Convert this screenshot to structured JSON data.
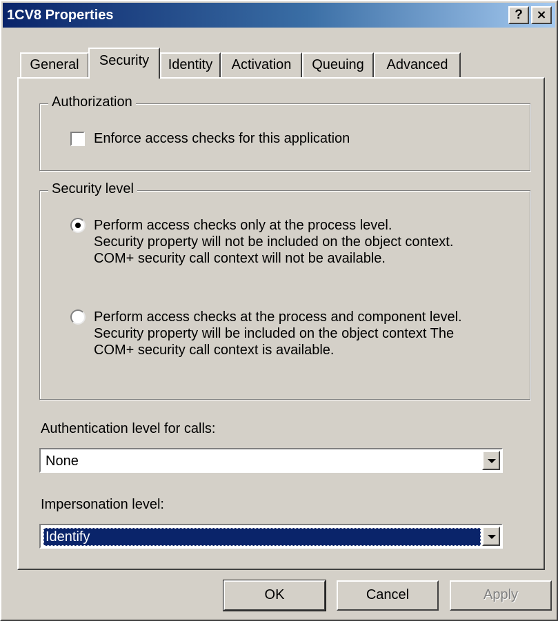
{
  "window": {
    "title": "1CV8 Properties",
    "help_label": "?",
    "close_label": "×"
  },
  "tabs": [
    {
      "label": "General",
      "active": false
    },
    {
      "label": "Security",
      "active": true
    },
    {
      "label": "Identity",
      "active": false
    },
    {
      "label": "Activation",
      "active": false
    },
    {
      "label": "Queuing",
      "active": false
    },
    {
      "label": "Advanced",
      "active": false
    }
  ],
  "authorization": {
    "legend": "Authorization",
    "checkbox_label": "Enforce access checks for this application",
    "checked": false
  },
  "security_level": {
    "legend": "Security level",
    "options": [
      {
        "selected": true,
        "lines": [
          "Perform access checks only at the process level.",
          "Security property will not be included on the object context.",
          "COM+ security call context will not be available."
        ]
      },
      {
        "selected": false,
        "lines": [
          "Perform access checks at the process and component level.",
          "Security property will be included on the object context  The",
          "COM+ security call context is available."
        ]
      }
    ]
  },
  "authentication": {
    "label": "Authentication level for calls:",
    "value": "None"
  },
  "impersonation": {
    "label": "Impersonation level:",
    "value": "Identify"
  },
  "buttons": {
    "ok": "OK",
    "cancel": "Cancel",
    "apply": "Apply"
  },
  "colors": {
    "face": "#d4d0c8",
    "title_active": "#0a246a",
    "selection": "#0a246a"
  }
}
